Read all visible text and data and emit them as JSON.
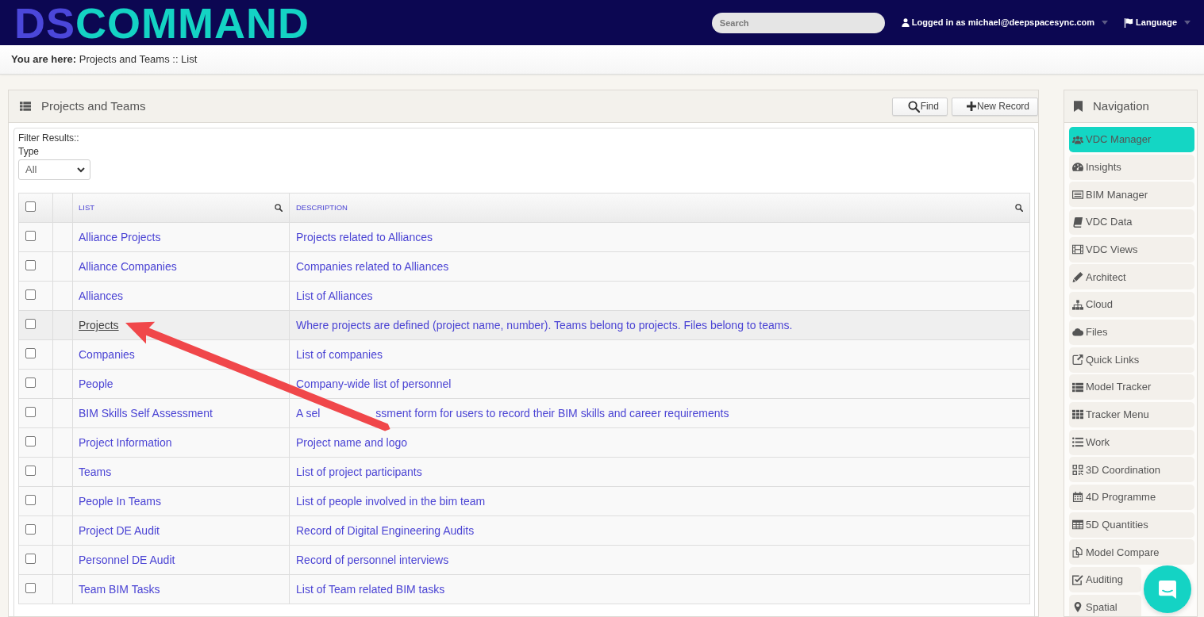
{
  "header": {
    "logo": {
      "prefix": "DS",
      "name": "COMMAND"
    },
    "search": {
      "placeholder": "Search"
    },
    "user_menu": {
      "label": "Logged in as michael@deepspacesync.com"
    },
    "language_menu": {
      "label": "Language"
    }
  },
  "breadcrumb": {
    "text": "**You are here:** Projects and Teams :: List"
  },
  "panel": {
    "title": "Projects and Teams",
    "buttons": [
      {
        "label": "Find"
      },
      {
        "label": "New Record"
      }
    ],
    "filter": {
      "heading": "Filter Results::",
      "label": "Type",
      "value": "All"
    },
    "table": {
      "select_all_checked": false,
      "columns": [
        "LIST",
        "DESCRIPTION"
      ],
      "rows": [
        {
          "list": "Alliance Projects",
          "description": [
            "Projects related to Alliances"
          ],
          "checked": false,
          "hovered": false
        },
        {
          "list": "Alliance Companies",
          "description": [
            "Companies related to Alliances"
          ],
          "checked": false,
          "hovered": false
        },
        {
          "list": "Alliances",
          "description": [
            "List of Alliances"
          ],
          "checked": false,
          "hovered": false
        },
        {
          "list": "Projects",
          "description": [
            "Where projects are defined (project name, number). Teams belong to projects. Files belong to teams."
          ],
          "checked": false,
          "hovered": true
        },
        {
          "list": "Companies",
          "description": [
            "List of companies"
          ],
          "checked": false,
          "hovered": false
        },
        {
          "list": "People",
          "description": [
            "Company-wide list of personnel"
          ],
          "checked": false,
          "hovered": false
        },
        {
          "list": "BIM Skills Self Assessment",
          "description": [
            "A sel",
            "ssment form for users to record their BIM skills and career requirements"
          ],
          "checked": false,
          "hovered": false
        },
        {
          "list": "Project Information",
          "description": [
            "Project name and logo"
          ],
          "checked": false,
          "hovered": false
        },
        {
          "list": "Teams",
          "description": [
            "List of project participants"
          ],
          "checked": false,
          "hovered": false
        },
        {
          "list": "People In Teams",
          "description": [
            "List of people involved in the bim team"
          ],
          "checked": false,
          "hovered": false
        },
        {
          "list": "Project DE Audit",
          "description": [
            "Record of Digital Engineering Audits"
          ],
          "checked": false,
          "hovered": false
        },
        {
          "list": "Personnel DE Audit",
          "description": [
            "Record of personnel interviews"
          ],
          "checked": false,
          "hovered": false
        },
        {
          "list": "Team BIM Tasks",
          "description": [
            "List of Team related BIM tasks"
          ],
          "checked": false,
          "hovered": false
        }
      ]
    }
  },
  "navigation": {
    "title": "Navigation",
    "items": [
      {
        "label": "VDC Manager",
        "selected": true
      },
      {
        "label": "Insights",
        "selected": false
      },
      {
        "label": "BIM Manager",
        "selected": false
      },
      {
        "label": "VDC Data",
        "selected": false
      },
      {
        "label": "VDC Views",
        "selected": false
      },
      {
        "label": "Architect",
        "selected": false
      },
      {
        "label": "Cloud",
        "selected": false
      },
      {
        "label": "Files",
        "selected": false
      },
      {
        "label": "Quick Links",
        "selected": false
      },
      {
        "label": "Model Tracker",
        "selected": false
      },
      {
        "label": "Tracker Menu",
        "selected": false
      },
      {
        "label": "Work",
        "selected": false
      },
      {
        "label": "3D Coordination",
        "selected": false
      },
      {
        "label": "4D Programme",
        "selected": false
      },
      {
        "label": "5D Quantities",
        "selected": false
      },
      {
        "label": "Model Compare",
        "selected": false
      },
      {
        "label": "Auditing",
        "selected": false
      },
      {
        "label": "Spatial",
        "selected": false
      }
    ]
  }
}
